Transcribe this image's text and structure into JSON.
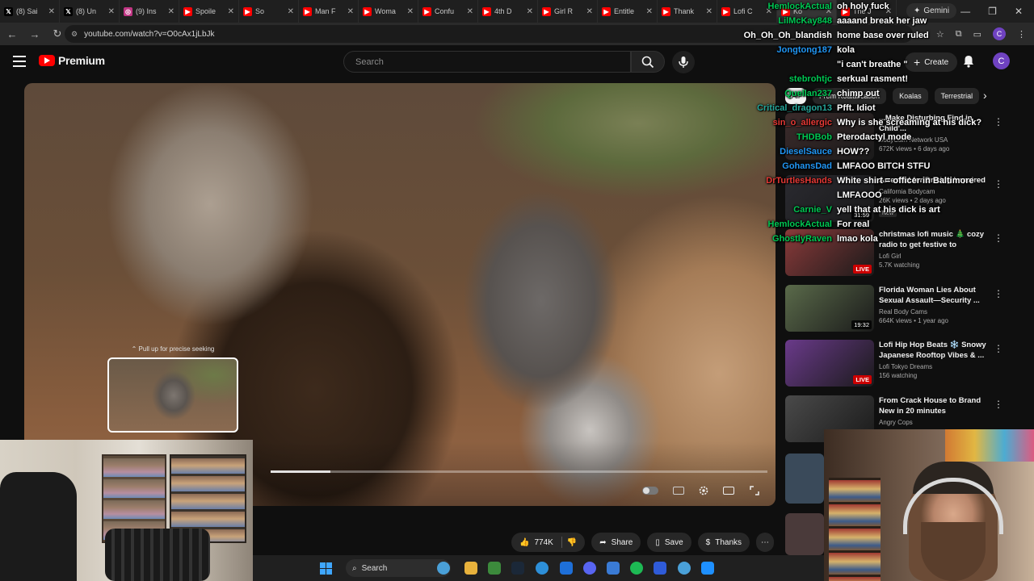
{
  "browser": {
    "tabs": [
      {
        "label": "(8) Sai",
        "icon": "x-icon",
        "color": "#000000"
      },
      {
        "label": "(8) Un",
        "icon": "x-icon",
        "color": "#000000"
      },
      {
        "label": "(9) Ins",
        "icon": "instagram-icon",
        "color": "#c13584"
      },
      {
        "label": "Spoile",
        "icon": "youtube-icon",
        "color": "#ff0000"
      },
      {
        "label": "So",
        "icon": "youtube-icon",
        "color": "#ff0000"
      },
      {
        "label": "Man F",
        "icon": "youtube-icon",
        "color": "#ff0000"
      },
      {
        "label": "Woma",
        "icon": "youtube-icon",
        "color": "#ff0000"
      },
      {
        "label": "Confu",
        "icon": "youtube-icon",
        "color": "#ff0000"
      },
      {
        "label": "4th D",
        "icon": "youtube-icon",
        "color": "#ff0000"
      },
      {
        "label": "Girl R",
        "icon": "youtube-icon",
        "color": "#ff0000"
      },
      {
        "label": "Entitle",
        "icon": "youtube-icon",
        "color": "#ff0000"
      },
      {
        "label": "Thank",
        "icon": "youtube-icon",
        "color": "#ff0000"
      },
      {
        "label": "Lofi C",
        "icon": "youtube-icon",
        "color": "#ff0000"
      },
      {
        "label": "Ko",
        "icon": "youtube-icon",
        "color": "#ff0000"
      },
      {
        "label": "The J",
        "icon": "youtube-icon",
        "color": "#ff0000"
      }
    ],
    "gemini_label": "Gemini",
    "url": "youtube.com/watch?v=O0cAx1jLbJk"
  },
  "youtube": {
    "logo_text": "Premium",
    "search_placeholder": "Search",
    "create_label": "Create",
    "avatar_letter": "C",
    "chips": [
      "All",
      "From Koalafication",
      "Koalas",
      "Terrestrial"
    ],
    "seek_hint": "Pull up for precise seeking",
    "progress_fraction": 0.12,
    "actions": {
      "like_count": "774K",
      "share_label": "Share",
      "save_label": "Save",
      "thanks_label": "Thanks"
    },
    "recommendations": [
      {
        "title": "...Make Disturbing Find in Child'...",
        "channel": "BodyCam Network USA",
        "stats": "672K views • 6 days ago",
        "badge": "",
        "thumb": "#3a2a2a"
      },
      {
        "title": "Arrested for Driving Impaired",
        "channel": "California Bodycam",
        "stats": "26K views • 2 days ago",
        "badge": "31:59",
        "badge_type": "duration",
        "new": "New",
        "thumb": "#2a2a30"
      },
      {
        "title": "christmas lofi music 🎄 cozy radio to get festive to",
        "channel": "Lofi Girl",
        "stats": "5.7K watching",
        "badge": "LIVE",
        "badge_type": "live",
        "thumb": "#8a3a3a"
      },
      {
        "title": "Florida Woman Lies About Sexual Assault—Security ...",
        "channel": "Real Body Cams",
        "stats": "664K views • 1 year ago",
        "badge": "19:32",
        "badge_type": "duration",
        "thumb": "#5a6a4a"
      },
      {
        "title": "Lofi Hip Hop Beats ❄️ Snowy Japanese Rooftop Vibes & ...",
        "channel": "Lofi Tokyo Dreams",
        "stats": "156 watching",
        "badge": "LIVE",
        "badge_type": "live",
        "thumb": "#6a3a8a"
      },
      {
        "title": "From Crack House to Brand New in 20 minutes",
        "channel": "Angry Cops",
        "stats": "",
        "badge": "",
        "thumb": "#4a4a4a"
      }
    ]
  },
  "chat": [
    {
      "name": "HemlockActual",
      "msg": "oh holy fuck",
      "color": "#00c853"
    },
    {
      "name": "LilMcKay848",
      "msg": "aaaand break her jaw",
      "color": "#00c853"
    },
    {
      "name": "Oh_Oh_Oh_blandish",
      "msg": "home base over ruled",
      "color": "#ffffff"
    },
    {
      "name": "Jongtong187",
      "msg": "kola",
      "color": "#2196f3"
    },
    {
      "name": "",
      "msg": "\"i can't breathe \"",
      "color": "#7c4dff"
    },
    {
      "name": "stebrohtjc",
      "msg": "serkual rasment!",
      "color": "#00c853"
    },
    {
      "name": "Quellan237",
      "msg": "chimp out",
      "color": "#00c853"
    },
    {
      "name": "Critical_dragon13",
      "msg": "Pfft. Idiot",
      "color": "#26a69a"
    },
    {
      "name": "sin_o_allergic",
      "msg": "Why is she screaming at his dick?",
      "color": "#e53935"
    },
    {
      "name": "THDBob",
      "msg": "Pterodactyl mode",
      "color": "#00c853"
    },
    {
      "name": "DieselSauce",
      "msg": "HOW??",
      "color": "#2196f3"
    },
    {
      "name": "GohansDad",
      "msg": "LMFAOO BITCH STFU",
      "color": "#2196f3"
    },
    {
      "name": "DrTurtlesHands",
      "msg": "White shirt = officer in Baltimore",
      "color": "#e53935"
    },
    {
      "name": "",
      "msg": "LMFAOOO",
      "color": "#e53935"
    },
    {
      "name": "Carnie_V",
      "msg": "yell that at his dick is art",
      "color": "#00c853"
    },
    {
      "name": "HemlockActual",
      "msg": "For real",
      "color": "#00c853"
    },
    {
      "name": "GhostlyRaven",
      "msg": "lmao kola",
      "color": "#00c853"
    }
  ],
  "taskbar": {
    "search_label": "Search"
  }
}
